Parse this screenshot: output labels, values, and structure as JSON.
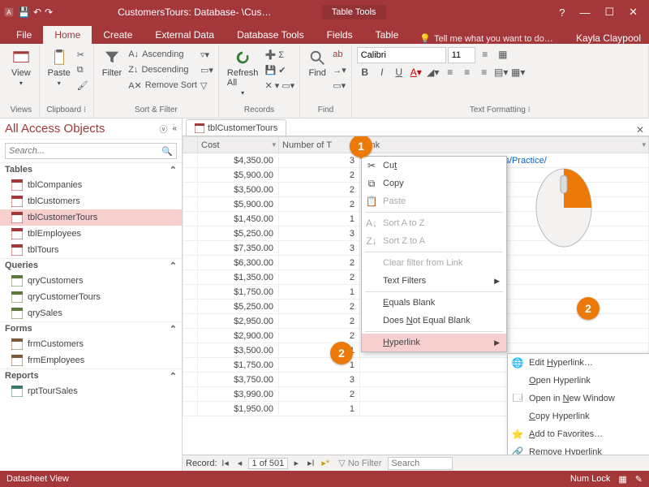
{
  "title": "CustomersTours: Database- \\Cus…",
  "tabletools": "Table Tools",
  "user": "Kayla Claypool",
  "tellme": "Tell me what you want to do…",
  "tabs": {
    "file": "File",
    "home": "Home",
    "create": "Create",
    "external": "External Data",
    "dbtools": "Database Tools",
    "fields": "Fields",
    "table": "Table"
  },
  "ribbon": {
    "view": "View",
    "paste": "Paste",
    "filter": "Filter",
    "refresh": "Refresh\nAll",
    "find": "Find",
    "asc": "Ascending",
    "desc": "Descending",
    "removesort": "Remove Sort",
    "groups": {
      "views": "Views",
      "clipboard": "Clipboard",
      "sort": "Sort & Filter",
      "records": "Records",
      "find": "Find",
      "format": "Text Formatting"
    },
    "font": "Calibri",
    "size": "11"
  },
  "nav": {
    "title": "All Access Objects",
    "search_ph": "Search...",
    "sections": {
      "tables": "Tables",
      "queries": "Queries",
      "forms": "Forms",
      "reports": "Reports"
    },
    "tables": [
      "tblCompanies",
      "tblCustomers",
      "tblCustomerTours",
      "tblEmployees",
      "tblTours"
    ],
    "queries": [
      "qryCustomers",
      "qryCustomerTours",
      "qrySales"
    ],
    "forms": [
      "frmCustomers",
      "frmEmployees"
    ],
    "reports": [
      "rptTourSales"
    ]
  },
  "sheet": {
    "tab": "tblCustomerTours",
    "columns": {
      "cost": "Cost",
      "num": "Number of T",
      "link": "Link"
    },
    "link_value": "C:/Users/Kayla Claypool/Documents/Practice/",
    "rows": [
      {
        "cost": "$4,350.00",
        "n": "3"
      },
      {
        "cost": "$5,900.00",
        "n": "2"
      },
      {
        "cost": "$3,500.00",
        "n": "2"
      },
      {
        "cost": "$5,900.00",
        "n": "2"
      },
      {
        "cost": "$1,450.00",
        "n": "1"
      },
      {
        "cost": "$5,250.00",
        "n": "3"
      },
      {
        "cost": "$7,350.00",
        "n": "3"
      },
      {
        "cost": "$6,300.00",
        "n": "2"
      },
      {
        "cost": "$1,350.00",
        "n": "2"
      },
      {
        "cost": "$1,750.00",
        "n": "1"
      },
      {
        "cost": "$5,250.00",
        "n": "2"
      },
      {
        "cost": "$2,950.00",
        "n": "2"
      },
      {
        "cost": "$2,900.00",
        "n": "2"
      },
      {
        "cost": "$3,500.00",
        "n": "1"
      },
      {
        "cost": "$1,750.00",
        "n": "1"
      },
      {
        "cost": "$3,750.00",
        "n": "3"
      },
      {
        "cost": "$3,990.00",
        "n": "2"
      },
      {
        "cost": "$1,950.00",
        "n": "1"
      }
    ],
    "recnav": {
      "label": "Record:",
      "pos": "1 of 501",
      "nofilter": "No Filter",
      "search_ph": "Search"
    }
  },
  "ctx": {
    "cut": "Cut",
    "copy": "Copy",
    "paste": "Paste",
    "sortaz": "Sort A to Z",
    "sortza": "Sort Z to A",
    "clearfilter": "Clear filter from Link",
    "textfilters": "Text Filters",
    "eqblank": "Equals Blank",
    "neqblank": "Does Not Equal Blank",
    "hyperlink": "Hyperlink"
  },
  "sub": {
    "edit": "Edit Hyperlink…",
    "open": "Open Hyperlink",
    "openwin": "Open in New Window",
    "copyhl": "Copy Hyperlink",
    "fav": "Add to Favorites…",
    "remove": "Remove Hyperlink"
  },
  "status": {
    "view": "Datasheet View",
    "numlock": "Num Lock"
  },
  "badges": {
    "b1": "1",
    "b2": "2"
  }
}
